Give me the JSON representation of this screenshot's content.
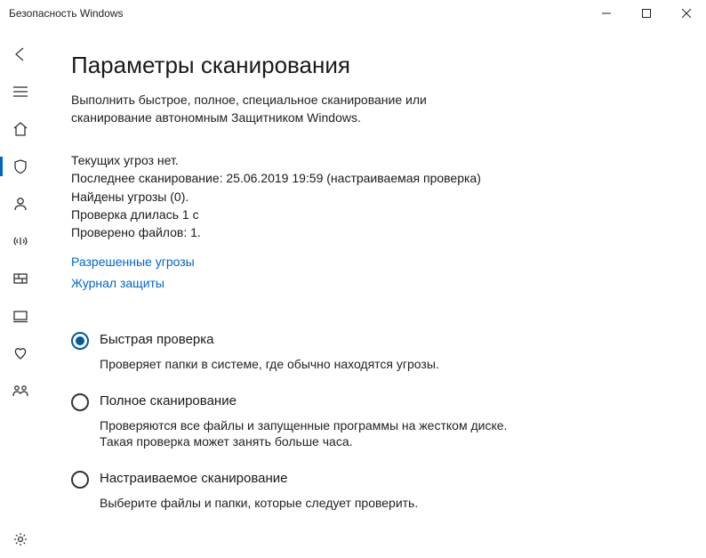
{
  "window": {
    "title": "Безопасность Windows"
  },
  "sidebar": {
    "items": [
      {
        "name": "back"
      },
      {
        "name": "menu"
      },
      {
        "name": "home"
      },
      {
        "name": "shield",
        "selected": true
      },
      {
        "name": "account"
      },
      {
        "name": "signal"
      },
      {
        "name": "firewall"
      },
      {
        "name": "device"
      },
      {
        "name": "health"
      },
      {
        "name": "family"
      }
    ],
    "settings": {
      "name": "settings"
    }
  },
  "page": {
    "heading": "Параметры сканирования",
    "subtitle": "Выполнить быстрое, полное, специальное сканирование или сканирование автономным Защитником Windows.",
    "status": {
      "no_threats": "Текущих угроз нет.",
      "last_scan": "Последнее сканирование: 25.06.2019 19:59 (настраиваемая проверка)",
      "threats_found": "Найдены угрозы (0).",
      "scan_duration": "Проверка длилась 1 с",
      "files_scanned": "Проверено файлов: 1."
    },
    "links": {
      "allowed_threats": "Разрешенные угрозы",
      "protection_log": "Журнал защиты"
    },
    "options": [
      {
        "title": "Быстрая проверка",
        "desc": "Проверяет папки в системе, где обычно находятся угрозы.",
        "selected": true
      },
      {
        "title": "Полное сканирование",
        "desc": "Проверяются все файлы и запущенные программы на жестком диске. Такая проверка может занять больше часа.",
        "selected": false
      },
      {
        "title": "Настраиваемое сканирование",
        "desc": "Выберите файлы и папки, которые следует проверить.",
        "selected": false
      }
    ]
  }
}
